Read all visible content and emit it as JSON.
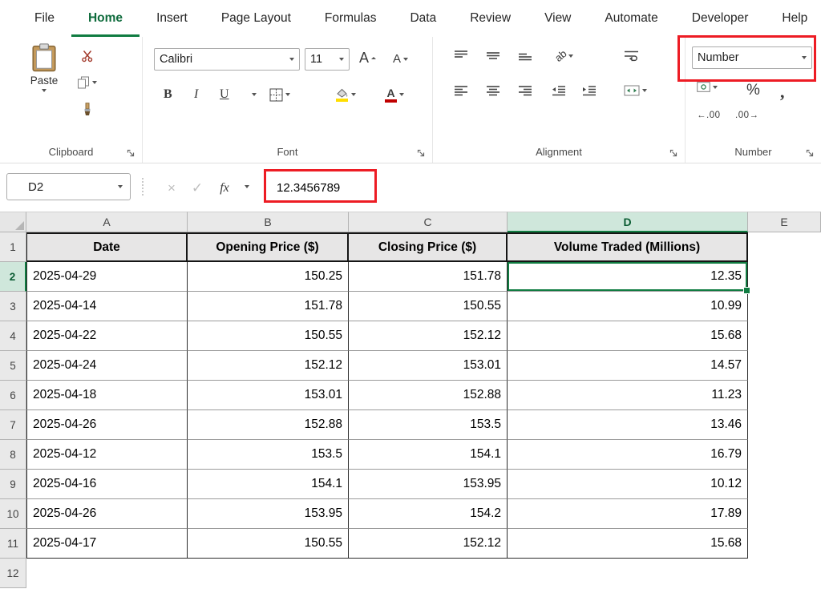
{
  "colors": {
    "excel_green": "#107C41",
    "selected_fill": "#CFE7DB",
    "table_header_fill": "#E7E6E6",
    "highlight_red": "#ED1C24",
    "fill_color_swatch": "#FFDE00",
    "font_color_swatch": "#C00000"
  },
  "ribbon": {
    "tabs": [
      "File",
      "Home",
      "Insert",
      "Page Layout",
      "Formulas",
      "Data",
      "Review",
      "View",
      "Automate",
      "Developer",
      "Help"
    ],
    "active_tab": "Home",
    "clipboard": {
      "label": "Clipboard",
      "paste": "Paste"
    },
    "font": {
      "label": "Font",
      "name": "Calibri",
      "size": "11",
      "bold": "B",
      "italic": "I",
      "underline": "U",
      "grow": "A",
      "shrink": "A"
    },
    "alignment": {
      "label": "Alignment",
      "orientation_text": "ab"
    },
    "number": {
      "label": "Number",
      "format": "Number",
      "percent": "%",
      "comma": ",",
      "increase_decimal": "←.00",
      "decrease_decimal": ".00→"
    }
  },
  "formula_bar": {
    "name_box": "D2",
    "cancel": "×",
    "enter": "✓",
    "fx": "fx",
    "value": "12.3456789"
  },
  "sheet": {
    "columns": [
      "A",
      "B",
      "C",
      "D",
      "E"
    ],
    "selected_column": "D",
    "selected_row": "2",
    "selected_cell": "D2",
    "row_numbers": [
      "1",
      "2",
      "3",
      "4",
      "5",
      "6",
      "7",
      "8",
      "9",
      "10",
      "11",
      "12"
    ],
    "header_row": [
      "Date",
      "Opening Price ($)",
      "Closing Price ($)",
      "Volume Traded (Millions)"
    ],
    "rows": [
      [
        "2025-04-29",
        "150.25",
        "151.78",
        "12.35"
      ],
      [
        "2025-04-14",
        "151.78",
        "150.55",
        "10.99"
      ],
      [
        "2025-04-22",
        "150.55",
        "152.12",
        "15.68"
      ],
      [
        "2025-04-24",
        "152.12",
        "153.01",
        "14.57"
      ],
      [
        "2025-04-18",
        "153.01",
        "152.88",
        "11.23"
      ],
      [
        "2025-04-26",
        "152.88",
        "153.5",
        "13.46"
      ],
      [
        "2025-04-12",
        "153.5",
        "154.1",
        "16.79"
      ],
      [
        "2025-04-16",
        "154.1",
        "153.95",
        "10.12"
      ],
      [
        "2025-04-26",
        "153.95",
        "154.2",
        "17.89"
      ],
      [
        "2025-04-17",
        "150.55",
        "152.12",
        "15.68"
      ]
    ]
  }
}
